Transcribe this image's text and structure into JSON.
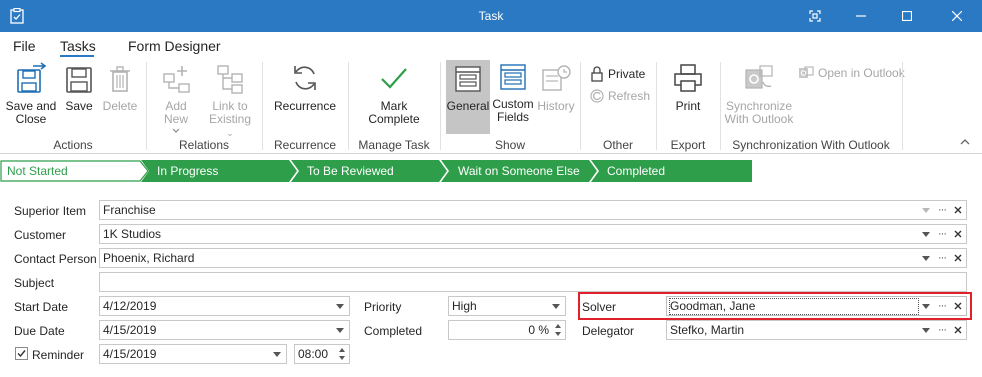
{
  "window": {
    "title": "Task",
    "icon": "clipboard-icon",
    "controls": [
      "restore-icon",
      "minimize-icon",
      "maximize-icon",
      "close-icon"
    ]
  },
  "menu": {
    "tabs": [
      "File",
      "Tasks",
      "Form Designer"
    ],
    "active": "Tasks"
  },
  "ribbon": {
    "groups": {
      "actions": "Actions",
      "relations": "Relations",
      "recurrence": "Recurrence",
      "manage_task": "Manage Task",
      "show": "Show",
      "other": "Other",
      "export": "Export",
      "sync": "Synchronization With Outlook"
    },
    "buttons": {
      "save_close_1": "Save and",
      "save_close_2": "Close",
      "save": "Save",
      "delete": "Delete",
      "add_new": "Add New",
      "link_1": "Link to",
      "link_2": "Existing",
      "recurrence": "Recurrence",
      "mark_complete": "Mark Complete",
      "general": "General",
      "custom_1": "Custom",
      "custom_2": "Fields",
      "history": "History",
      "private": "Private",
      "refresh": "Refresh",
      "print": "Print",
      "sync_1": "Synchronize",
      "sync_2": "With Outlook",
      "open_outlook": "Open in Outlook"
    }
  },
  "stages": [
    "Not Started",
    "In Progress",
    "To Be Reviewed",
    "Wait on Someone Else",
    "Completed"
  ],
  "stage_colors": {
    "active_bg": "#ffffff",
    "active_text": "#2e9e4a",
    "step_bg": "#2e9e4a"
  },
  "form": {
    "superior_item": {
      "label": "Superior Item",
      "value": "Franchise"
    },
    "customer": {
      "label": "Customer",
      "value": "1K Studios"
    },
    "contact_person": {
      "label": "Contact Person",
      "value": "Phoenix, Richard"
    },
    "subject": {
      "label": "Subject",
      "value": ""
    },
    "start_date": {
      "label": "Start Date",
      "value": "4/12/2019"
    },
    "due_date": {
      "label": "Due Date",
      "value": "4/15/2019"
    },
    "reminder": {
      "label": "Reminder",
      "checked": true,
      "date": "4/15/2019",
      "time": "08:00"
    },
    "priority": {
      "label": "Priority",
      "value": "High"
    },
    "completed": {
      "label": "Completed",
      "value": "0 %"
    },
    "solver": {
      "label": "Solver",
      "value": "Goodman, Jane"
    },
    "delegator": {
      "label": "Delegator",
      "value": "Stefko, Martin"
    }
  },
  "colors": {
    "titlebar": "#2b79c2",
    "highlight": "#e0202a"
  }
}
